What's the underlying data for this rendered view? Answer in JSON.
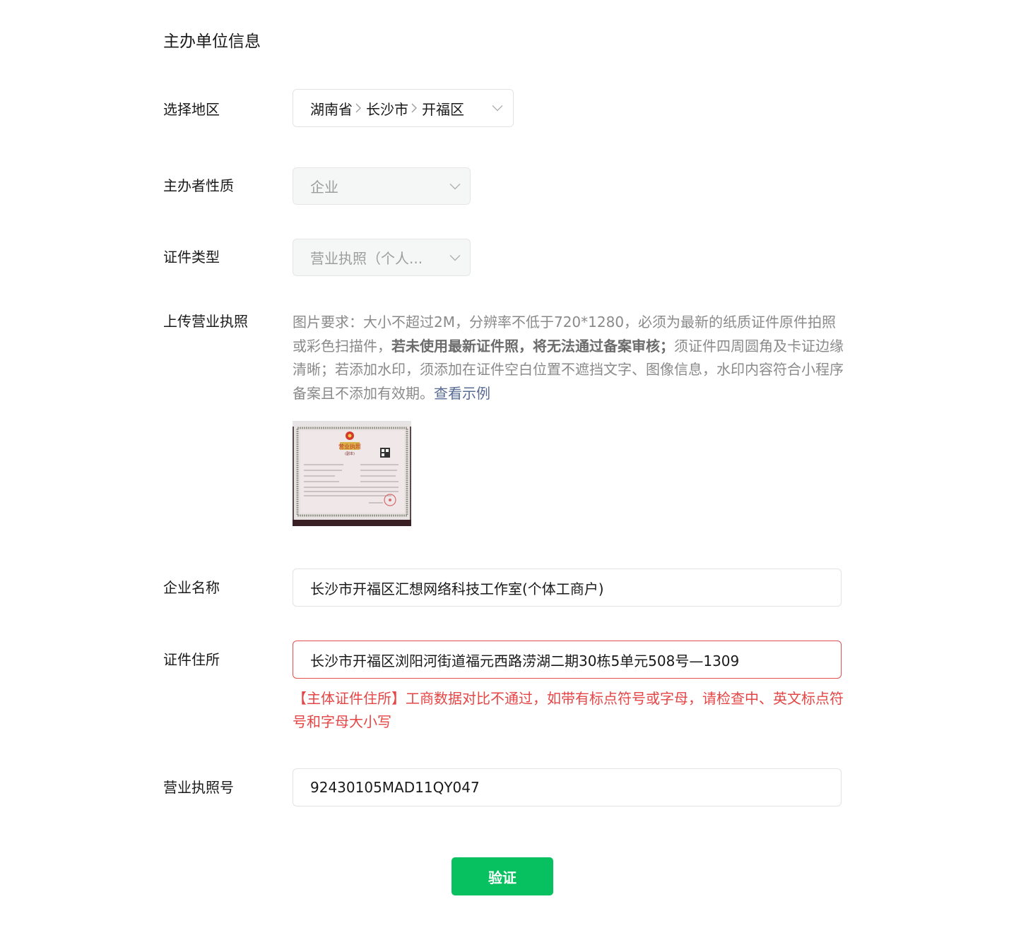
{
  "section": {
    "title": "主办单位信息"
  },
  "region": {
    "label": "选择地区",
    "province": "湖南省",
    "city": "长沙市",
    "district": "开福区"
  },
  "organizer_type": {
    "label": "主办者性质",
    "value": "企业"
  },
  "cert_type": {
    "label": "证件类型",
    "value": "营业执照（个人..."
  },
  "upload": {
    "label": "上传营业执照",
    "desc_part1": "图片要求：大小不超过2M，分辨率不低于720*1280，必须为最新的纸质证件原件拍照或彩色扫描件，",
    "desc_bold": "若未使用最新证件照，将无法通过备案审核；",
    "desc_part2": "须证件四周圆角及卡证边缘清晰；若添加水印，须添加在证件空白位置不遮挡文字、图像信息，水印内容符合小程序备案且不添加有效期。",
    "example_link": "查看示例",
    "image": {
      "title": "营业执照",
      "subtitle": "(副本)"
    }
  },
  "company_name": {
    "label": "企业名称",
    "value": "长沙市开福区汇想网络科技工作室(个体工商户)"
  },
  "cert_address": {
    "label": "证件住所",
    "value": "长沙市开福区浏阳河街道福元西路涝湖二期30栋5单元508号—1309",
    "error": "【主体证件住所】工商数据对比不通过，如带有标点符号或字母，请检查中、英文标点符号和字母大小写"
  },
  "license_number": {
    "label": "营业执照号",
    "value": "92430105MAD11QY047"
  },
  "verify_button": {
    "label": "验证"
  },
  "colors": {
    "primary": "#07c160",
    "error": "#e64545",
    "link": "#576b95",
    "muted": "#8a8a8a"
  }
}
